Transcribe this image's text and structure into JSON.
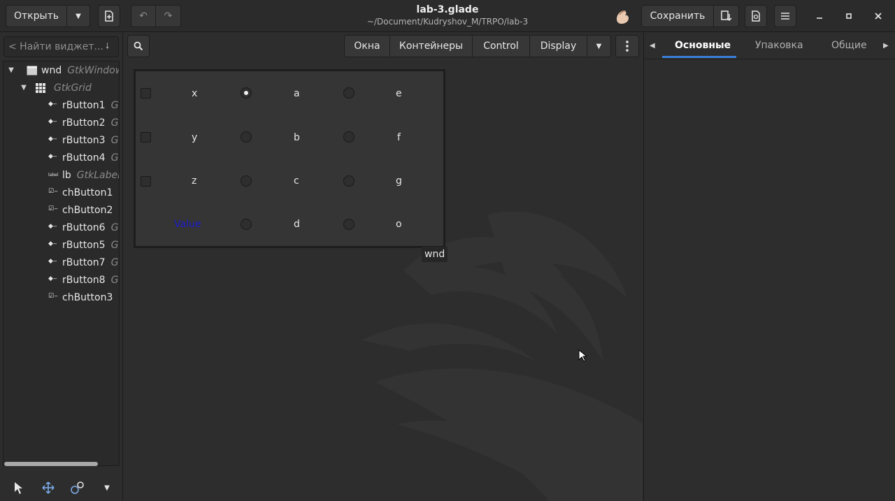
{
  "header": {
    "open_label": "Открыть",
    "title": "lab-3.glade",
    "subtitle": "~/Document/Kudryshov_M/TRPO/lab-3",
    "save_label": "Сохранить"
  },
  "left": {
    "search_placeholder": "< Найти виджет...",
    "tree": [
      {
        "name": "wnd",
        "cls": "GtkWindow"
      },
      {
        "name": "",
        "cls": "GtkGrid"
      },
      {
        "name": "rButton1",
        "cls": "G"
      },
      {
        "name": "rButton2",
        "cls": "G"
      },
      {
        "name": "rButton3",
        "cls": "G"
      },
      {
        "name": "rButton4",
        "cls": "G"
      },
      {
        "name": "lb",
        "cls": "GtkLabel"
      },
      {
        "name": "chButton1",
        "cls": ""
      },
      {
        "name": "chButton2",
        "cls": ""
      },
      {
        "name": "rButton6",
        "cls": "G"
      },
      {
        "name": "rButton5",
        "cls": "G"
      },
      {
        "name": "rButton7",
        "cls": "G"
      },
      {
        "name": "rButton8",
        "cls": "G"
      },
      {
        "name": "chButton3",
        "cls": ""
      }
    ]
  },
  "center": {
    "categories": [
      "Окна",
      "Контейнеры",
      "Control",
      "Display"
    ],
    "grid": {
      "row1": [
        "x",
        "a",
        "e"
      ],
      "row2": [
        "y",
        "b",
        "f"
      ],
      "row3": [
        "z",
        "c",
        "g"
      ],
      "row4": [
        "Value",
        "d",
        "o"
      ]
    },
    "window_tag": "wnd"
  },
  "right": {
    "tabs": [
      "Основные",
      "Упаковка",
      "Общие"
    ]
  },
  "colors": {
    "accent": "#3d7fd6",
    "value_label": "#1a1acc"
  }
}
